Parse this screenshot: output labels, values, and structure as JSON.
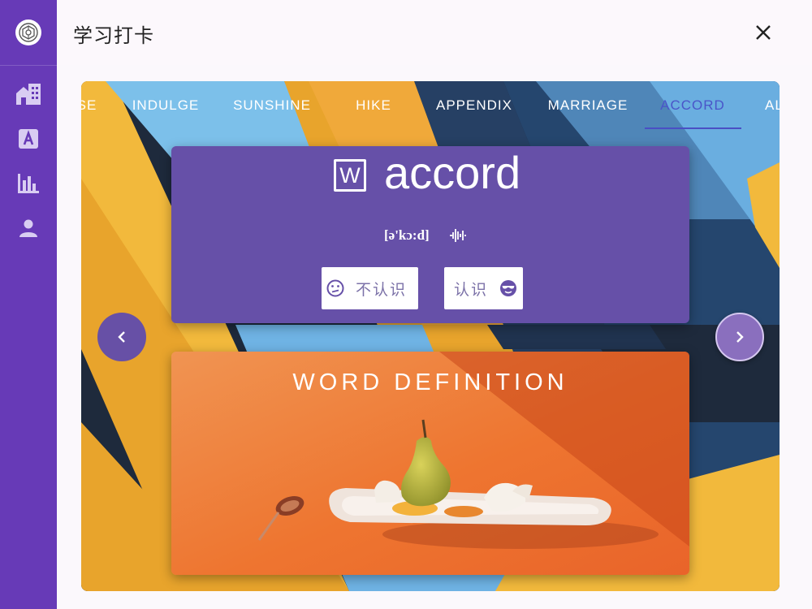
{
  "app": {
    "title": "学习打卡"
  },
  "rail": {
    "items": [
      {
        "icon": "buildings-icon"
      },
      {
        "icon": "font-a-icon"
      },
      {
        "icon": "bar-chart-icon"
      },
      {
        "icon": "person-icon"
      }
    ]
  },
  "tabs": [
    {
      "label": "SE"
    },
    {
      "label": "INDULGE"
    },
    {
      "label": "SUNSHINE"
    },
    {
      "label": "HIKE"
    },
    {
      "label": "APPENDIX"
    },
    {
      "label": "MARRIAGE"
    },
    {
      "label": "ACCORD",
      "active": true
    },
    {
      "label": "AL"
    }
  ],
  "word": {
    "text": "accord",
    "phonetic": "[ə'kɔ:d]",
    "icon_letter": "W",
    "unknown_label": "不认识",
    "known_label": "认识"
  },
  "definition": {
    "title": "WORD DEFINITION"
  },
  "colors": {
    "primary": "#673ab7",
    "card": "#6650a8",
    "accent": "#4a55c9"
  }
}
